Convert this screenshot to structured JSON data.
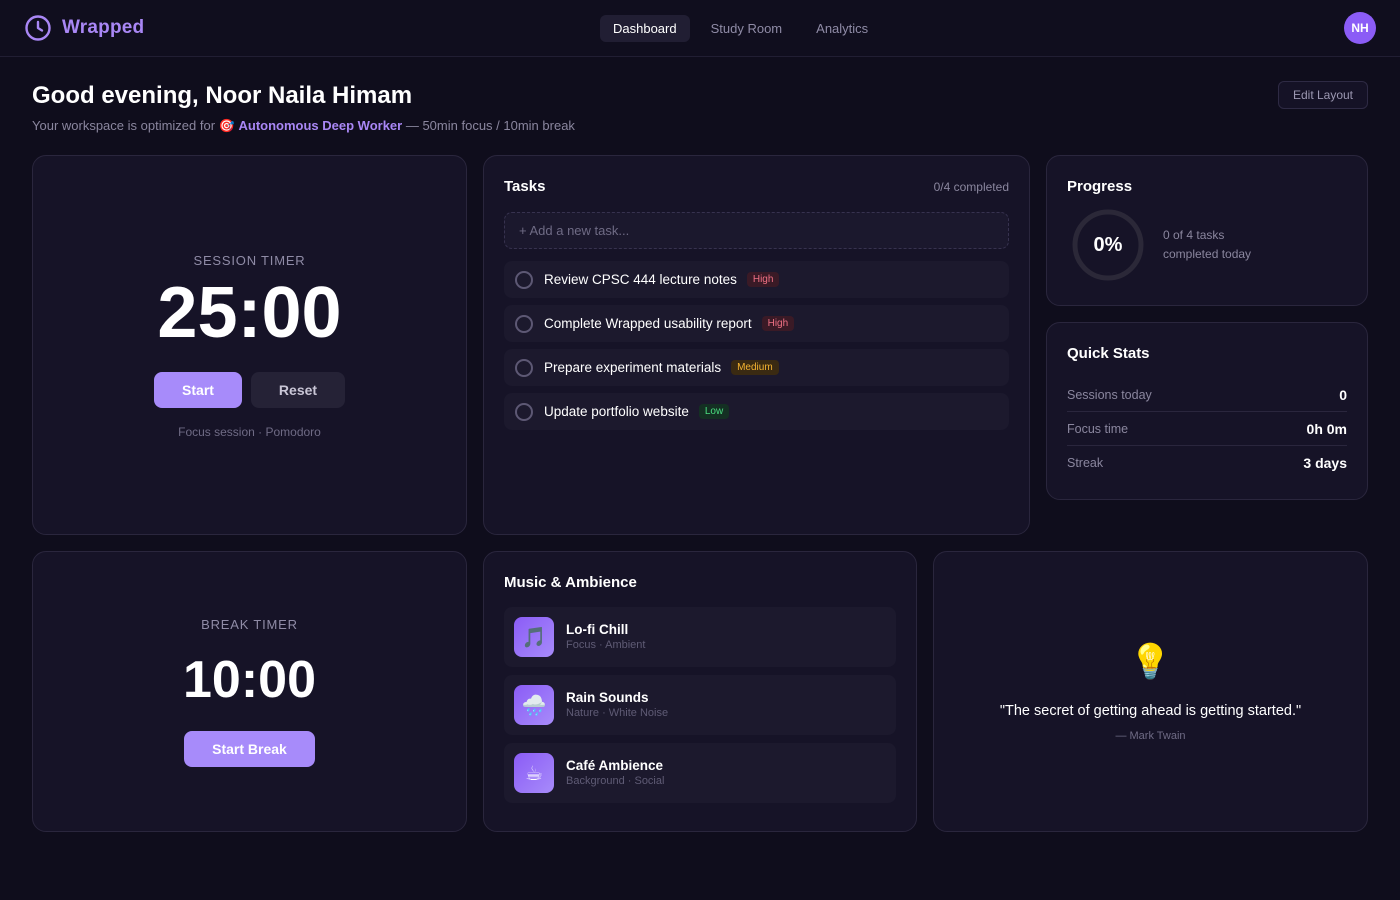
{
  "header": {
    "brand": "Wrapped",
    "tabs": [
      {
        "label": "Dashboard",
        "active": true
      },
      {
        "label": "Study Room",
        "active": false
      },
      {
        "label": "Analytics",
        "active": false
      }
    ],
    "avatar_initials": "NH"
  },
  "greeting": {
    "title": "Good evening, Noor Naila Himam",
    "sub_prefix": "Your workspace is optimized for",
    "persona_icon": "🎯",
    "persona": "Autonomous Deep Worker",
    "sub_suffix": "— 50min focus / 10min break",
    "edit_label": "Edit Layout"
  },
  "session_timer": {
    "label": "SESSION TIMER",
    "time": "25:00",
    "start_label": "Start",
    "reset_label": "Reset",
    "caption": "Focus session · Pomodoro"
  },
  "tasks": {
    "title": "Tasks",
    "count": "0/4 completed",
    "placeholder": "+ Add a new task...",
    "items": [
      {
        "text": "Review CPSC 444 lecture notes",
        "priority": "High"
      },
      {
        "text": "Complete Wrapped usability report",
        "priority": "High"
      },
      {
        "text": "Prepare experiment materials",
        "priority": "Medium"
      },
      {
        "text": "Update portfolio website",
        "priority": "Low"
      }
    ]
  },
  "progress": {
    "title": "Progress",
    "percent": "0%",
    "fraction": 0,
    "line1": "0 of 4 tasks",
    "line2": "completed today"
  },
  "quick_stats": {
    "title": "Quick Stats",
    "rows": [
      {
        "label": "Sessions today",
        "value": "0"
      },
      {
        "label": "Focus time",
        "value": "0h 0m"
      },
      {
        "label": "Streak",
        "value": "3 days"
      }
    ]
  },
  "break_timer": {
    "label": "BREAK TIMER",
    "time": "10:00",
    "start_label": "Start Break"
  },
  "music": {
    "title": "Music & Ambience",
    "tracks": [
      {
        "icon": "🎵",
        "name": "Lo-fi Chill",
        "meta": "Focus · Ambient"
      },
      {
        "icon": "🌧️",
        "name": "Rain Sounds",
        "meta": "Nature · White Noise"
      },
      {
        "icon": "☕",
        "name": "Café Ambience",
        "meta": "Background · Social"
      }
    ]
  },
  "quote": {
    "icon": "💡",
    "text": "\"The secret of getting ahead is getting started.\"",
    "author": "— Mark Twain"
  },
  "colors": {
    "accent": "#a78bfa",
    "brand": "#a987f5",
    "background": "#0f0d1c",
    "card": "#161327"
  }
}
